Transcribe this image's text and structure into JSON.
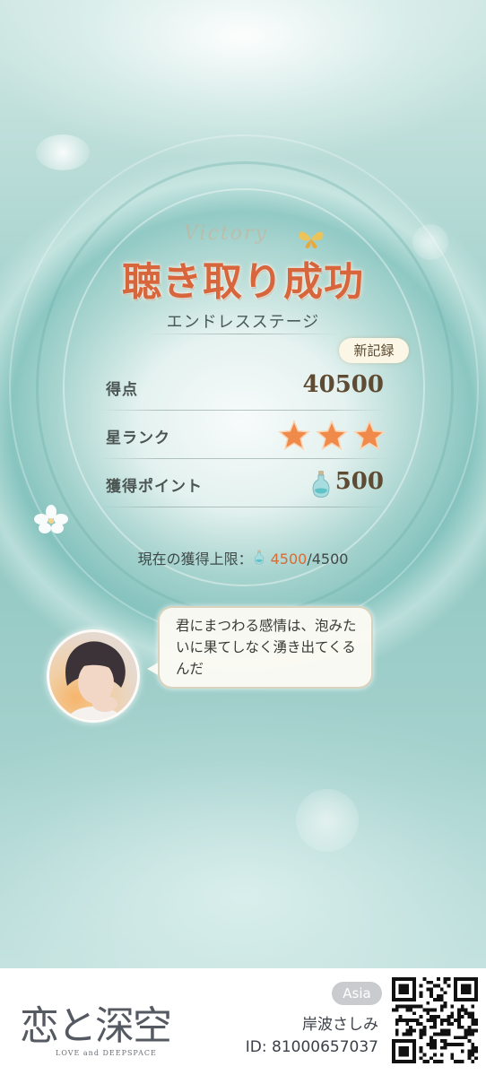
{
  "result": {
    "decor_script": "Victory",
    "title": "聴き取り成功",
    "stage_name": "エンドレスステージ",
    "new_record_badge": "新記録"
  },
  "stats": {
    "score_label": "得点",
    "score_value": "40500",
    "rank_label": "星ランク",
    "rank_stars": 3,
    "points_label": "獲得ポイント",
    "points_value": "500"
  },
  "cap": {
    "label": "現在の獲得上限：",
    "current": "4500",
    "separator": "/",
    "max": "4500"
  },
  "dialogue": {
    "text": "君にまつわる感情は、泡みたいに果てしなく湧き出てくるんだ"
  },
  "footer": {
    "logo_text": "恋と深空",
    "logo_subtext": "LOVE and DEEPSPACE",
    "region": "Asia",
    "player_name": "岸波さしみ",
    "player_id": "ID: 81000657037"
  },
  "colors": {
    "title": "#d8663c",
    "star": "#f08a4b",
    "cap_current": "#d76c35"
  },
  "icons": [
    "butterfly-icon",
    "star-icon",
    "bottle-icon",
    "flower-decoration",
    "qr-code"
  ]
}
